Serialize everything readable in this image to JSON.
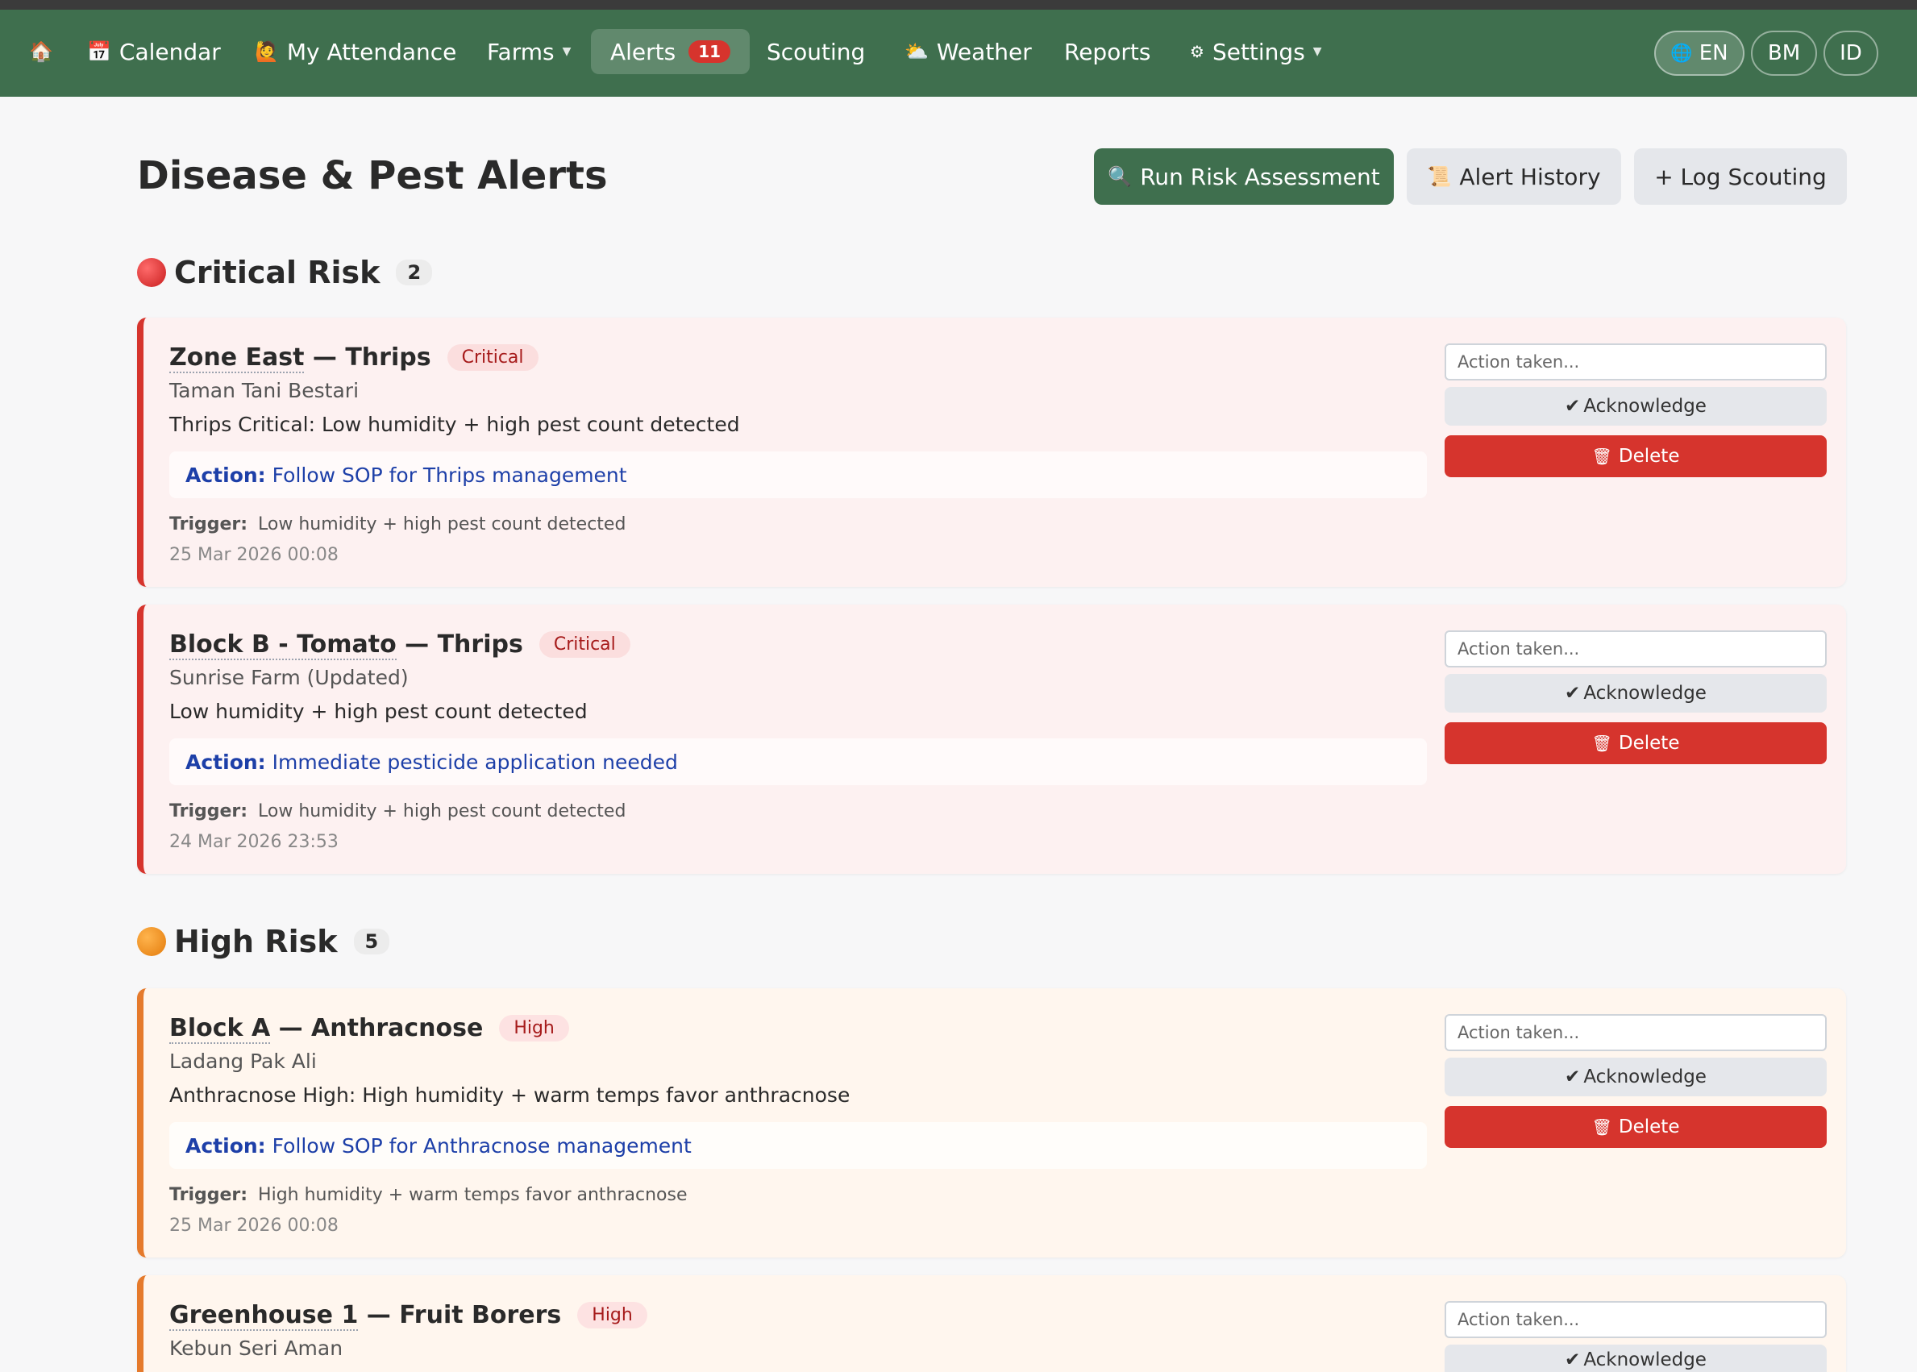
{
  "nav": {
    "home_icon": "home-icon",
    "items": [
      {
        "icon": "📅",
        "label": "Calendar"
      },
      {
        "icon": "🙋",
        "label": "My Attendance"
      },
      {
        "label": "Farms"
      },
      {
        "label": "Alerts",
        "badge": "11"
      },
      {
        "label": "Scouting"
      },
      {
        "icon": "⛅",
        "label": "Weather"
      },
      {
        "label": "Reports"
      },
      {
        "icon": "⚙",
        "label": "Settings"
      }
    ],
    "languages": [
      {
        "icon": "🌐",
        "label": "EN"
      },
      {
        "label": "BM"
      },
      {
        "label": "ID"
      }
    ]
  },
  "page": {
    "title": "Disease & Pest Alerts",
    "buttons": {
      "run": {
        "icon": "🔍",
        "label": "Run Risk Assessment"
      },
      "history": {
        "icon": "📜",
        "label": "Alert History"
      },
      "log": {
        "label": "+ Log Scouting"
      }
    }
  },
  "sections": [
    {
      "title": "Critical Risk",
      "count": "2",
      "alerts": [
        {
          "zone": "Zone East",
          "pest": " — Thrips",
          "level": "Critical",
          "farm": "Taman Tani Bestari",
          "message": "Thrips Critical: Low humidity + high pest count detected",
          "action_label": "Action:",
          "action": "Follow SOP for Thrips management",
          "trigger_label": "Trigger:",
          "trigger": "Low humidity + high pest count detected",
          "date": "25 Mar 2026 00:08",
          "input_placeholder": "Action taken...",
          "ack_label": "Acknowledge",
          "delete_label": "Delete"
        },
        {
          "zone": "Block B - Tomato",
          "pest": " — Thrips",
          "level": "Critical",
          "farm": "Sunrise Farm (Updated)",
          "message": "Low humidity + high pest count detected",
          "action_label": "Action:",
          "action": "Immediate pesticide application needed",
          "trigger_label": "Trigger:",
          "trigger": "Low humidity + high pest count detected",
          "date": "24 Mar 2026 23:53",
          "input_placeholder": "Action taken...",
          "ack_label": "Acknowledge",
          "delete_label": "Delete"
        }
      ]
    },
    {
      "title": "High Risk",
      "count": "5",
      "alerts": [
        {
          "zone": "Block A",
          "pest": " — Anthracnose",
          "level": "High",
          "farm": "Ladang Pak Ali",
          "message": "Anthracnose High: High humidity + warm temps favor anthracnose",
          "action_label": "Action:",
          "action": "Follow SOP for Anthracnose management",
          "trigger_label": "Trigger:",
          "trigger": "High humidity + warm temps favor anthracnose",
          "date": "25 Mar 2026 00:08",
          "input_placeholder": "Action taken...",
          "ack_label": "Acknowledge",
          "delete_label": "Delete"
        },
        {
          "zone": "Greenhouse 1",
          "pest": " — Fruit Borers",
          "level": "High",
          "farm": "Kebun Seri Aman",
          "input_placeholder": "Action taken...",
          "ack_label": "Acknowledge"
        }
      ]
    }
  ],
  "colors": {
    "nav_bg": "#3f6f4e",
    "critical_accent": "#d6342d",
    "high_accent": "#e57a2c",
    "link": "#1d3fa8"
  }
}
